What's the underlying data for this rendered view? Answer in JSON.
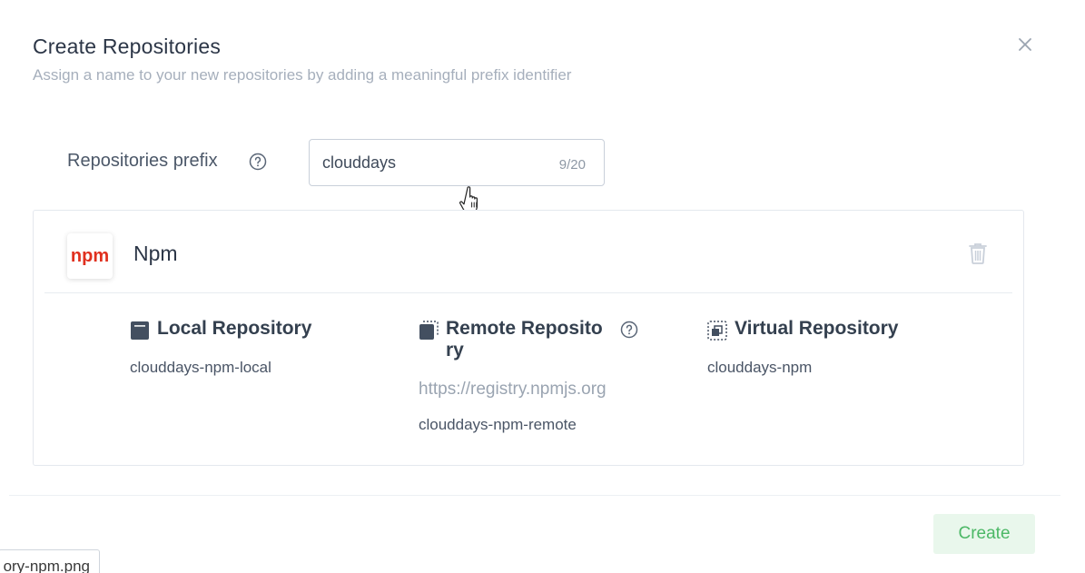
{
  "dialog": {
    "title": "Create Repositories",
    "subtitle": "Assign a name to your new repositories by adding a meaningful prefix identifier",
    "close_icon": "close-icon"
  },
  "prefix": {
    "label": "Repositories prefix",
    "value": "clouddays",
    "char_count": "9/20",
    "help_icon": "question-circle-icon"
  },
  "package": {
    "logo_text": "npm",
    "name": "Npm",
    "trash_icon": "trash-icon",
    "colors": {
      "logo_text": "#e0301e"
    },
    "local": {
      "title": "Local Repository",
      "repo_name": "clouddays-npm-local",
      "icon": "local-repo-icon"
    },
    "remote": {
      "title": "Remote Reposito ry",
      "url": "https://registry.npmjs.org",
      "repo_name": "clouddays-npm-remote",
      "icon": "remote-repo-icon"
    },
    "virtual": {
      "title": "Virtual Repository",
      "repo_name": "clouddays-npm",
      "icon": "virtual-repo-icon"
    }
  },
  "footer": {
    "create_label": "Create",
    "colors": {
      "create_bg": "#e9f7ec",
      "create_text": "#4cb866"
    }
  },
  "tooltip": {
    "text": "ory-npm.png"
  }
}
